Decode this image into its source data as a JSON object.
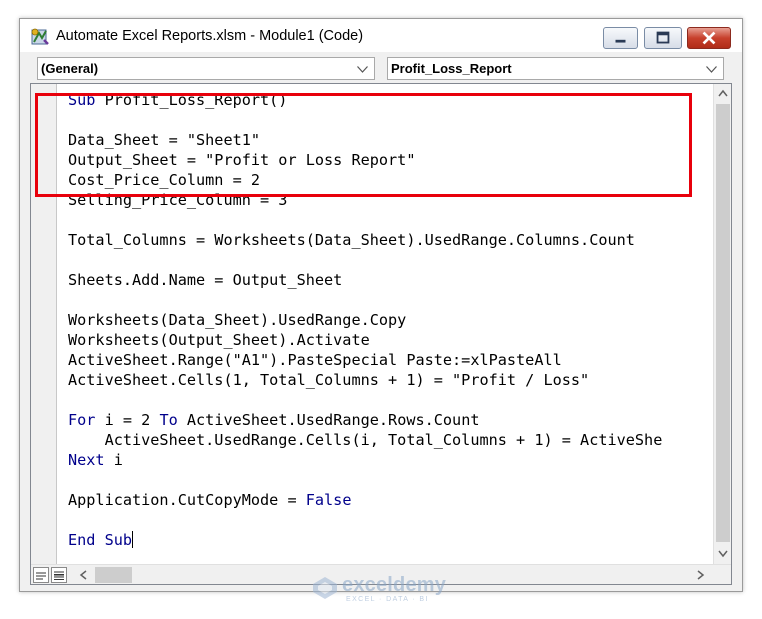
{
  "window": {
    "title": "Automate Excel Reports.xlsm - Module1 (Code)"
  },
  "toolbar": {
    "object_combo": "(General)",
    "procedure_combo": "Profit_Loss_Report"
  },
  "code_lines": [
    [
      {
        "t": "Sub",
        "kw": true
      },
      {
        "t": " Profit_Loss_Report()"
      }
    ],
    [],
    [
      {
        "t": "Data_Sheet = \"Sheet1\""
      }
    ],
    [
      {
        "t": "Output_Sheet = \"Profit or Loss Report\""
      }
    ],
    [
      {
        "t": "Cost_Price_Column = 2"
      }
    ],
    [
      {
        "t": "Selling_Price_Column = 3"
      }
    ],
    [],
    [
      {
        "t": "Total_Columns = Worksheets(Data_Sheet).UsedRange.Columns.Count"
      }
    ],
    [],
    [
      {
        "t": "Sheets.Add.Name = Output_Sheet"
      }
    ],
    [],
    [
      {
        "t": "Worksheets(Data_Sheet).UsedRange.Copy"
      }
    ],
    [
      {
        "t": "Worksheets(Output_Sheet).Activate"
      }
    ],
    [
      {
        "t": "ActiveSheet.Range(\"A1\").PasteSpecial Paste:=xlPasteAll"
      }
    ],
    [
      {
        "t": "ActiveSheet.Cells(1, Total_Columns + 1) = \"Profit / Loss\""
      }
    ],
    [],
    [
      {
        "t": "For",
        "kw": true
      },
      {
        "t": " i = 2 "
      },
      {
        "t": "To",
        "kw": true
      },
      {
        "t": " ActiveSheet.UsedRange.Rows.Count"
      }
    ],
    [
      {
        "t": "    ActiveSheet.UsedRange.Cells(i, Total_Columns + 1) = ActiveShe"
      }
    ],
    [
      {
        "t": "Next",
        "kw": true
      },
      {
        "t": " i"
      }
    ],
    [],
    [
      {
        "t": "Application.CutCopyMode = "
      },
      {
        "t": "False",
        "kw": true
      }
    ],
    [],
    [
      {
        "t": "End Sub",
        "kw": true
      }
    ]
  ],
  "watermark": {
    "name": "exceldemy",
    "tagline": "EXCEL · DATA · BI"
  },
  "colors": {
    "keyword": "#00008b",
    "highlight_box": "#e8000b"
  }
}
